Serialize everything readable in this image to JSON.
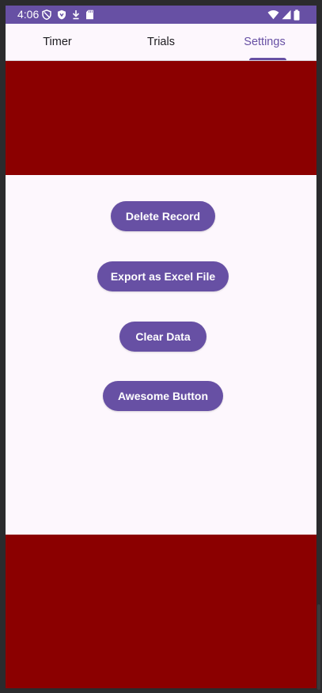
{
  "status_bar": {
    "time": "4:06",
    "left_icons": [
      "privacy-shield-icon",
      "vpn-shield-icon",
      "download-icon",
      "sd-card-icon"
    ],
    "right_icons": [
      "wifi-icon",
      "cellular-signal-icon",
      "battery-icon"
    ]
  },
  "tabs": [
    {
      "label": "Timer",
      "active": false
    },
    {
      "label": "Trials",
      "active": false
    },
    {
      "label": "Settings",
      "active": true
    }
  ],
  "buttons": {
    "delete_record": "Delete Record",
    "export_excel": "Export as Excel File",
    "clear_data": "Clear Data",
    "awesome": "Awesome Button"
  },
  "colors": {
    "accent": "#6750a4",
    "banner": "#8b0000",
    "background": "#fdf7fd"
  }
}
